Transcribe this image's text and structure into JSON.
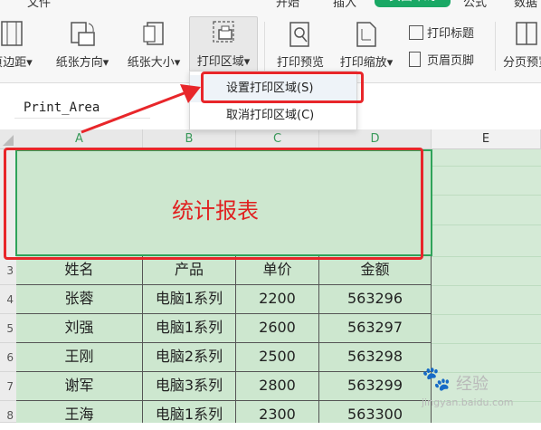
{
  "ribbon": {
    "tabs_partial": [
      "文件",
      "开始",
      "插入",
      "页面布局",
      "公式",
      "数据"
    ],
    "active_tab": "页面布局",
    "buttons": {
      "margins": "页边距",
      "orientation": "纸张方向",
      "size": "纸张大小",
      "print_area": "打印区域",
      "print_preview": "打印预览",
      "print_scale": "打印缩放",
      "print_titles": "打印标题",
      "header_footer": "页眉页脚",
      "page_break": "分页预览"
    }
  },
  "name_box": {
    "value": "Print_Area"
  },
  "print_area_menu": {
    "set": "设置打印区域(S)",
    "cancel": "取消打印区域(C)"
  },
  "sheet": {
    "columns": [
      "A",
      "B",
      "C",
      "D",
      "E"
    ],
    "row_numbers": [
      "3",
      "4",
      "5",
      "6",
      "7",
      "8"
    ],
    "title": "统计报表",
    "headers": [
      "姓名",
      "产品",
      "单价",
      "金额"
    ],
    "rows": [
      [
        "张蓉",
        "电脑1系列",
        "2200",
        "563296"
      ],
      [
        "刘强",
        "电脑1系列",
        "2600",
        "563297"
      ],
      [
        "王刚",
        "电脑2系列",
        "2500",
        "563298"
      ],
      [
        "谢军",
        "电脑3系列",
        "2800",
        "563299"
      ],
      [
        "王海",
        "电脑1系列",
        "2300",
        "563300"
      ]
    ]
  },
  "watermark": {
    "text": "经验",
    "sub": "jingyan.baidu.com"
  },
  "colors": {
    "accent": "#1aa865",
    "highlight": "#e8262a",
    "selection_fill": "#cde7cf"
  }
}
